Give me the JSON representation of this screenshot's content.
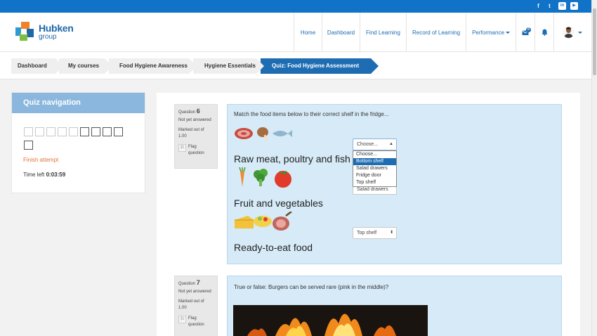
{
  "social": [
    {
      "icon": "facebook-icon",
      "glyph": "f"
    },
    {
      "icon": "twitter-icon",
      "glyph": "t"
    },
    {
      "icon": "linkedin-icon",
      "glyph": "in"
    },
    {
      "icon": "youtube-icon",
      "glyph": "▶"
    }
  ],
  "brand": {
    "line1": "Hubken",
    "line2": "group"
  },
  "nav": {
    "home": "Home",
    "dashboard": "Dashboard",
    "find_learning": "Find Learning",
    "record": "Record of Learning",
    "performance": "Performance",
    "messages_count": "0"
  },
  "breadcrumb": [
    "Dashboard",
    "My courses",
    "Food Hygiene Awareness",
    "Hygiene Essentials",
    "Quiz: Food Hygiene Assessment"
  ],
  "quiz_nav": {
    "title": "Quiz navigation",
    "finish": "Finish attempt",
    "time_label": "Time left",
    "time_value": "0:03:59"
  },
  "question6": {
    "label": "Question",
    "number": "6",
    "status": "Not yet answered",
    "marks": "Marked out of 1.00",
    "flag": "Flag question",
    "text": "Match the food items below to their correct shelf in the fridge...",
    "items": [
      "Raw meat, poultry and fish",
      "Fruit and vegetables",
      "Ready-to-eat food"
    ],
    "select1_value": "Choose...",
    "select2_value": "Salad drawers",
    "select3_value": "Top shelf",
    "options": [
      "Choose...",
      "Bottom shelf",
      "Salad drawers",
      "Fridge door",
      "Top shelf"
    ]
  },
  "question7": {
    "label": "Question",
    "number": "7",
    "status": "Not yet answered",
    "marks": "Marked out of 1.00",
    "flag": "Flag question",
    "text": "True or false: Burgers can be served rare (pink in the middle)?"
  }
}
